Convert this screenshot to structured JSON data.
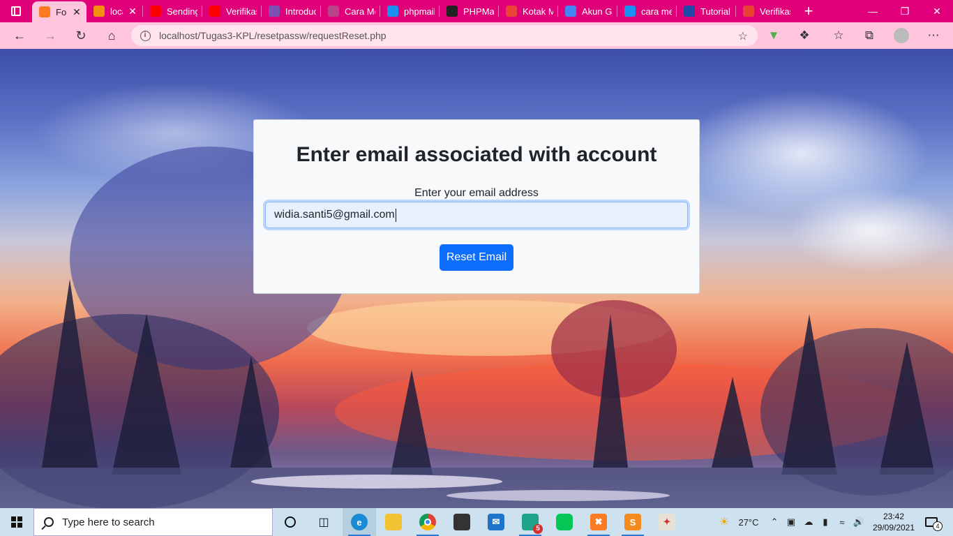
{
  "browser": {
    "tabs": [
      {
        "label": "Forg",
        "favicon": "xampp-icon",
        "color": "#fb7a24",
        "active": true
      },
      {
        "label": "loca",
        "favicon": "phpmyadmin-icon",
        "color": "#f29111",
        "active": false
      },
      {
        "label": "Sending",
        "favicon": "youtube-icon",
        "color": "#ff0000",
        "active": false
      },
      {
        "label": "Verifikasi",
        "favicon": "youtube-icon",
        "color": "#ff0000",
        "active": false
      },
      {
        "label": "Introduct",
        "favicon": "bootstrap-icon",
        "color": "#7952b3",
        "active": false
      },
      {
        "label": "Cara Mer",
        "favicon": "loading-icon",
        "color": "#b48",
        "active": false
      },
      {
        "label": "phpmaile",
        "favicon": "bing-icon",
        "color": "#1b8ef0",
        "active": false
      },
      {
        "label": "PHPMaile",
        "favicon": "github-icon",
        "color": "#222222",
        "active": false
      },
      {
        "label": "Kotak Ma",
        "favicon": "gmail-icon",
        "color": "#ea4335",
        "active": false
      },
      {
        "label": "Akun Go",
        "favicon": "google-icon",
        "color": "#4285f4",
        "active": false
      },
      {
        "label": "cara mer",
        "favicon": "bing-icon",
        "color": "#1b8ef0",
        "active": false
      },
      {
        "label": "Tutorial",
        "favicon": "dj-icon",
        "color": "#1f4aa8",
        "active": false
      },
      {
        "label": "Verifikasi",
        "favicon": "gmail-icon",
        "color": "#ea4335",
        "active": false
      }
    ],
    "new_tab_symbol": "+",
    "url": "localhost/Tugas3-KPL/resetpassw/requestReset.php",
    "theme_color": "#e0007a"
  },
  "form": {
    "title": "Enter email associated with account",
    "label": "Enter your email address",
    "email_value": "widia.santi5@gmail.com",
    "button_label": "Reset Email",
    "button_color": "#0d6efd"
  },
  "taskbar": {
    "search_placeholder": "Type here to search",
    "weather_temp": "27°C",
    "time": "23:42",
    "date": "29/09/2021",
    "notification_count": "4",
    "whatsapp_badge": "5"
  }
}
